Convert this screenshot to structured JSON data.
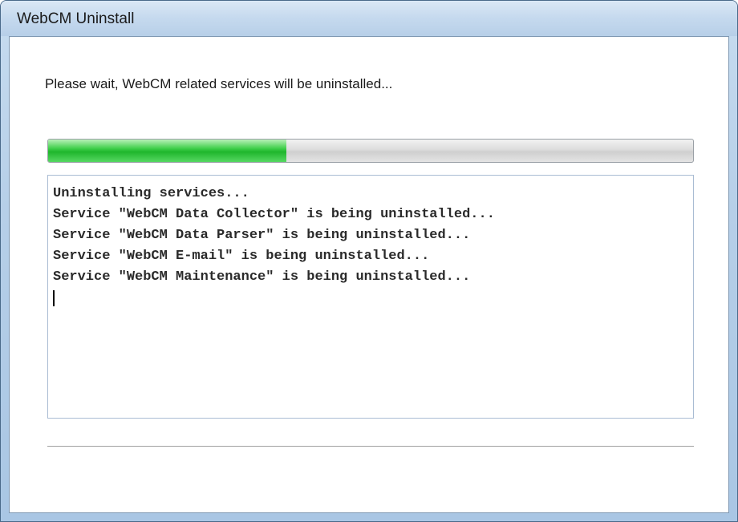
{
  "window": {
    "title": "WebCM Uninstall"
  },
  "message": "Please wait, WebCM related services will be uninstalled...",
  "progress": {
    "percent": 37,
    "color": "#1fb62c"
  },
  "log": {
    "lines": [
      "Uninstalling services...",
      "Service \"WebCM Data Collector\" is being uninstalled...",
      "Service \"WebCM Data Parser\" is being uninstalled...",
      "Service \"WebCM E-mail\" is being uninstalled...",
      "Service \"WebCM Maintenance\" is being uninstalled..."
    ]
  }
}
